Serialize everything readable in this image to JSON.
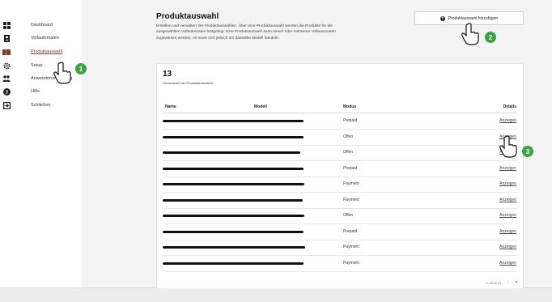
{
  "sidebar": {
    "items": [
      {
        "label": "Dashboard",
        "icon": "dashboard-grid-icon",
        "active": false
      },
      {
        "label": "Vollautomaten",
        "icon": "coffee-machine-icon",
        "active": false
      },
      {
        "label": "Produktauswahl",
        "icon": "product-selection-icon",
        "active": true
      },
      {
        "label": "Setup",
        "icon": "gear-icon",
        "active": false
      },
      {
        "label": "Anwenderverwaltung",
        "icon": "users-icon",
        "active": false
      },
      {
        "label": "Hilfe",
        "icon": "help-icon",
        "active": false
      },
      {
        "label": "Schließen",
        "icon": "logout-icon",
        "active": false
      }
    ]
  },
  "header": {
    "title": "Produktauswahl",
    "description": "Erstellen und verwalten Sie Produktauswahlen. Über eine Produktauswahl werden die Produkte für die ausgewählten Vollautomaten festgelegt. Eine Produktauswahl kann einem oder mehreren Vollautomaten zugewiesen werden, es muss sich jedoch um dasselbe Modell handeln.",
    "add_button_label": "Produktauswahl hinzufügen"
  },
  "summary": {
    "count": "13",
    "count_label": "Gesamtzahl der Produktauswahlen"
  },
  "table": {
    "columns": [
      "Name",
      "Modell",
      "Modus",
      "Details"
    ],
    "rows": [
      {
        "mode": "Prepaid",
        "details": "Anzeigen"
      },
      {
        "mode": "Offen",
        "details": "Anzeigen"
      },
      {
        "mode": "Offen",
        "details": "Anzeigen"
      },
      {
        "mode": "Prepaid",
        "details": "Anzeigen"
      },
      {
        "mode": "Payment",
        "details": "Anzeigen"
      },
      {
        "mode": "Payment",
        "details": "Anzeigen"
      },
      {
        "mode": "Offen",
        "details": "Anzeigen"
      },
      {
        "mode": "Prepaid",
        "details": "Anzeigen"
      },
      {
        "mode": "Payment",
        "details": "Anzeigen"
      },
      {
        "mode": "Payment",
        "details": "Anzeigen"
      }
    ]
  },
  "pagination": {
    "range": "1–10 of 13",
    "prev": "‹",
    "next": "›"
  },
  "annotations": {
    "badge1": "1",
    "badge2": "2",
    "badge3": "3",
    "badge_color": "#3aa343"
  },
  "colors": {
    "active_nav": "#7a3d1e",
    "background": "#f3f3f3"
  }
}
